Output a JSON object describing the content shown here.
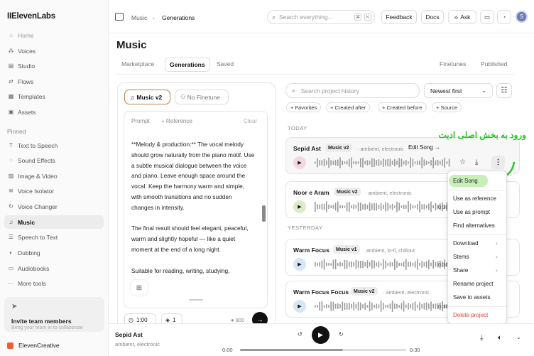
{
  "sidebar": {
    "logo": "IIElevenLabs",
    "items": [
      {
        "label": "Home",
        "icon": "home-icon",
        "glyph": "⌂",
        "dim": true
      },
      {
        "label": "Voices",
        "icon": "voices-icon",
        "glyph": "⁂",
        "dim": false
      },
      {
        "label": "Studio",
        "icon": "studio-icon",
        "glyph": "▤",
        "dim": false
      },
      {
        "label": "Flows",
        "icon": "flows-icon",
        "glyph": "⇄",
        "dim": false
      },
      {
        "label": "Templates",
        "icon": "templates-icon",
        "glyph": "▦",
        "dim": false
      },
      {
        "label": "Assets",
        "icon": "assets-icon",
        "glyph": "▣",
        "dim": false
      }
    ],
    "pinned_label": "Pinned",
    "pinned": [
      {
        "label": "Text to Speech",
        "icon": "text-to-speech-icon",
        "glyph": "T"
      },
      {
        "label": "Sound Effects",
        "icon": "sound-effects-icon",
        "glyph": "◌"
      },
      {
        "label": "Image & Video",
        "icon": "image-video-icon",
        "glyph": "▨"
      },
      {
        "label": "Voice Isolator",
        "icon": "voice-isolator-icon",
        "glyph": "≋"
      },
      {
        "label": "Voice Changer",
        "icon": "voice-changer-icon",
        "glyph": "↻"
      },
      {
        "label": "Music",
        "icon": "music-icon",
        "glyph": "♫",
        "active": true
      },
      {
        "label": "Speech to Text",
        "icon": "speech-to-text-icon",
        "glyph": "☰"
      },
      {
        "label": "Dubbing",
        "icon": "dubbing-icon",
        "glyph": "◐"
      },
      {
        "label": "Audiobooks",
        "icon": "audiobooks-icon",
        "glyph": "▭"
      },
      {
        "label": "More tools",
        "icon": "more-tools-icon",
        "glyph": "⋯"
      }
    ],
    "invite_title": "Invite team members",
    "invite_sub": "Bring your team in to collaborate",
    "workspace": "ElevenCreative"
  },
  "topbar": {
    "crumb1": "Music",
    "crumb_sep": "›",
    "crumb2": "Generations",
    "search_placeholder": "Search everything...",
    "kbd1": "⌘",
    "kbd2": "K",
    "feedback": "Feedback",
    "docs": "Docs",
    "ask": "Ask",
    "avatar": "S"
  },
  "page": {
    "title": "Music",
    "tabs": [
      "Marketplace",
      "Generations",
      "Saved"
    ],
    "right_tabs": [
      "Finetunes",
      "Published"
    ]
  },
  "composer": {
    "model_pill": "Music v2",
    "finetune_pill": "No Finetune",
    "prompt_label": "Prompt",
    "reference_label": "+ Reference",
    "clear_label": "Clear",
    "paragraphs": [
      "**Melody & production:** The vocal melody should grow naturally from the piano motif. Use a subtle musical dialogue between the voice and piano. Leave enough space around the vocal. Keep the harmony warm and simple, with smooth transitions and no sudden changes in intensity.",
      "The final result should feel elegant, peaceful, warm and slightly hopeful — like a quiet moment at the end of a long night.",
      "Suitable for reading, writing, studying,"
    ],
    "duration": "1:00",
    "variants": "1",
    "credits": "900"
  },
  "history": {
    "search_placeholder": "Search project history",
    "sort": "Newest first",
    "filters": [
      "+ Favorites",
      "+ Created after",
      "+ Created before",
      "+ Source"
    ],
    "today_label": "TODAY",
    "yesterday_label": "YESTERDAY",
    "tracks": [
      {
        "name": "Sepid Ast",
        "badge": "Music v2",
        "tags": "· ambient, electronic",
        "duration": "0:30",
        "play_color": "#f5d7e4"
      },
      {
        "name": "Noor e Aram",
        "badge": "Music v2",
        "tags": "· ambient, electronic",
        "duration": "0:30",
        "play_color": "#dcecc7"
      },
      {
        "name": "Warm Focus",
        "badge": "Music v1",
        "tags": "· ambient, lo-fi, chillout",
        "duration": "0:30",
        "play_color": "#d6e6f5"
      },
      {
        "name": "Warm Focus Focus",
        "badge": "Music v2",
        "tags": "· ambient, electronic",
        "duration": "0:30",
        "play_color": "#d6e6f5"
      }
    ],
    "edit_song_link": "Edit Song →"
  },
  "menu": {
    "edit_song": "Edit Song",
    "use_as_reference": "Use as reference",
    "use_as_prompt": "Use as prompt",
    "find_alternatives": "Find alternatives",
    "download": "Download",
    "stems": "Stems",
    "share": "Share",
    "rename": "Rename project",
    "save_to_assets": "Save to assets",
    "delete": "Delete project"
  },
  "annotation": "ورود به بخش اصلی ادیت",
  "player": {
    "title": "Sepid Ast",
    "tags": "ambient, electronic",
    "current_time": "0:00",
    "total_time": "0:30",
    "progress": 0.62
  },
  "colors": {
    "accent": "#c07e4b",
    "annotation": "#2dc12d",
    "menu_highlight": "#c7f0b9",
    "danger": "#d9463f"
  }
}
